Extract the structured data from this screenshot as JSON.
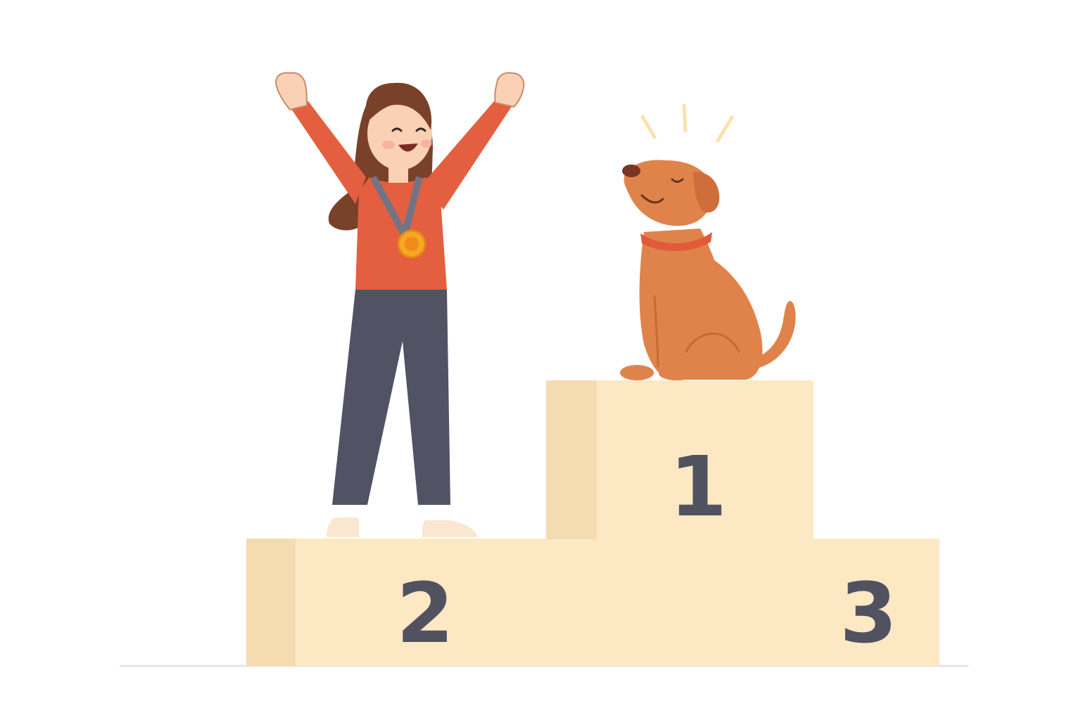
{
  "scene": {
    "podium": {
      "first_place_label": "1",
      "second_place_label": "2",
      "third_place_label": "3"
    },
    "colors": {
      "background": "#ffffff",
      "podium_face": "#fde8c4",
      "podium_side": "#f5dbb0",
      "digit": "#50525f",
      "shirt": "#e35f3f",
      "pants": "#515364",
      "hair": "#7a412a",
      "skin": "#fbd1b5",
      "medal": "#f6a623",
      "dog_fur": "#e0834a",
      "dog_collar": "#e15a3a",
      "sparkle": "#f9e2b0"
    },
    "icons": [
      "gold-medal-icon",
      "sparkle-lines-icon"
    ]
  }
}
